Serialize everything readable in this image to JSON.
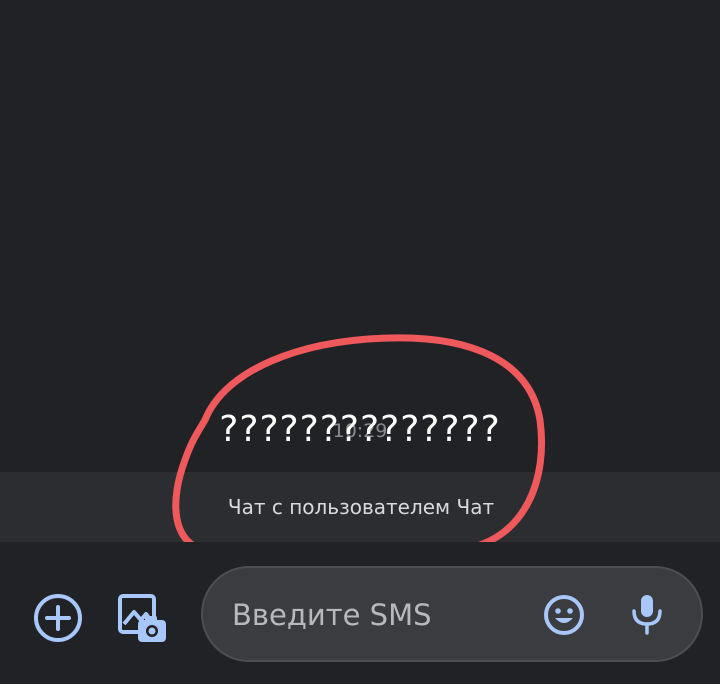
{
  "conversation": {
    "timestamp": "10:29",
    "message_text": "??????????????",
    "banner_text": "Чат с пользователем Чат"
  },
  "composer": {
    "input_placeholder": "Введите SMS",
    "icons": {
      "add": "add-circle-icon",
      "gallery": "gallery-camera-icon",
      "emoji": "emoji-icon",
      "mic": "microphone-icon"
    }
  },
  "colors": {
    "background": "#212226",
    "banner_bg": "#2c2d31",
    "input_bg": "#3b3c40",
    "accent_icon": "#a8c7fa",
    "annotation": "#f0595b"
  }
}
